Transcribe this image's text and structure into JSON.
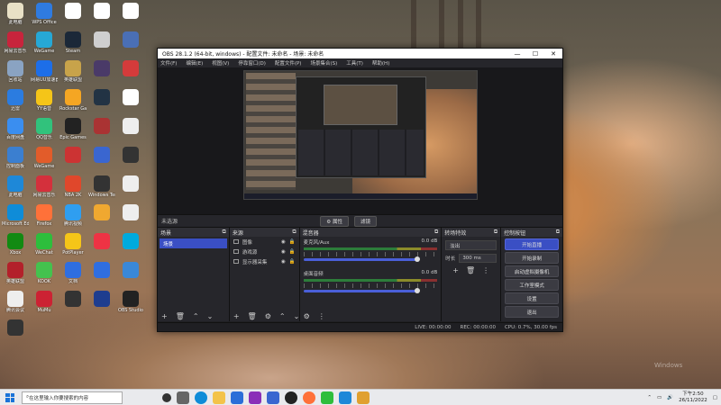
{
  "desktop": {
    "icons": [
      {
        "label": "此电脑",
        "color": "#e9e1c6"
      },
      {
        "label": "WPS Office",
        "color": "#2f7be0"
      },
      {
        "label": "",
        "color": "#ffffff"
      },
      {
        "label": "",
        "color": "#ffffff"
      },
      {
        "label": "",
        "color": "#ffffff"
      },
      {
        "label": "网易云音乐",
        "color": "#c8243c"
      },
      {
        "label": "WeGame",
        "color": "#26a8d6"
      },
      {
        "label": "Steam",
        "color": "#1b2838"
      },
      {
        "label": "",
        "color": "#cfcfcf"
      },
      {
        "label": "",
        "color": "#4a6fb5"
      },
      {
        "label": "回收站",
        "color": "#8aa3c2"
      },
      {
        "label": "网易UU加速器",
        "color": "#1d6ee8"
      },
      {
        "label": "英雄联盟",
        "color": "#c8a34a"
      },
      {
        "label": "",
        "color": "#4a3a68"
      },
      {
        "label": "",
        "color": "#d43b3b"
      },
      {
        "label": "迅雷",
        "color": "#2b7ce0"
      },
      {
        "label": "YY语音",
        "color": "#f5c518"
      },
      {
        "label": "Rockstar Games",
        "color": "#f5a623"
      },
      {
        "label": "",
        "color": "#234"
      },
      {
        "label": "",
        "color": "#fff"
      },
      {
        "label": "百度网盘",
        "color": "#3a8ef0"
      },
      {
        "label": "QQ音乐",
        "color": "#31c27c"
      },
      {
        "label": "Epic Games",
        "color": "#222"
      },
      {
        "label": "",
        "color": "#a33"
      },
      {
        "label": "",
        "color": "#eee"
      },
      {
        "label": "控制面板",
        "color": "#3b7fd0"
      },
      {
        "label": "WeGame",
        "color": "#e25c2a"
      },
      {
        "label": "",
        "color": "#cc3333"
      },
      {
        "label": "",
        "color": "#3a66d0"
      },
      {
        "label": "",
        "color": "#333"
      },
      {
        "label": "此电脑",
        "color": "#1e88d8"
      },
      {
        "label": "网易云音乐",
        "color": "#d4303c"
      },
      {
        "label": "NBA 2K",
        "color": "#e0472b"
      },
      {
        "label": "Windows Terminal",
        "color": "#333"
      },
      {
        "label": "",
        "color": "#eee"
      },
      {
        "label": "Microsoft Edge",
        "color": "#0f8cd8"
      },
      {
        "label": "Firefox",
        "color": "#ff7139"
      },
      {
        "label": "腾讯视频",
        "color": "#2f9ef0"
      },
      {
        "label": "",
        "color": "#f0a830"
      },
      {
        "label": "",
        "color": "#eee"
      },
      {
        "label": "Xbox",
        "color": "#128a12"
      },
      {
        "label": "WeChat",
        "color": "#2dbe3c"
      },
      {
        "label": "PotPlayer",
        "color": "#f5c518"
      },
      {
        "label": "",
        "color": "#e34"
      },
      {
        "label": "",
        "color": "#0ad"
      },
      {
        "label": "英雄联盟",
        "color": "#b3202a"
      },
      {
        "label": "KOOK",
        "color": "#44c24e"
      },
      {
        "label": "文档",
        "color": "#2f6ee0"
      },
      {
        "label": "",
        "color": "#2f6ee0"
      },
      {
        "label": "",
        "color": "#3a88d8"
      },
      {
        "label": "腾讯会议",
        "color": "#eee"
      },
      {
        "label": "MuMu",
        "color": "#cc2233"
      },
      {
        "label": "",
        "color": "#333"
      },
      {
        "label": "",
        "color": "#1e3d8f"
      },
      {
        "label": "OBS Studio",
        "color": "#222"
      },
      {
        "label": "",
        "color": "#333"
      }
    ],
    "watermark": "Windows"
  },
  "obs": {
    "title": "OBS 28.1.2 (64-bit, windows) - 配置文件: 未命名 - 场景: 未命名",
    "window_buttons": [
      "—",
      "☐",
      "✕"
    ],
    "menu": [
      "文件(F)",
      "编辑(E)",
      "视图(V)",
      "停靠窗口(D)",
      "配置文件(P)",
      "场景集合(S)",
      "工具(T)",
      "帮助(H)"
    ],
    "source_bar": {
      "name": "未选源",
      "properties": "属性",
      "filters": "滤镜"
    },
    "scenes": {
      "title": "场景",
      "items": [
        "场景"
      ]
    },
    "sources": {
      "title": "来源",
      "items": [
        "图像",
        "游戏源",
        "显示器采集"
      ]
    },
    "mixer": {
      "title": "混音器",
      "channels": [
        {
          "name": "麦克风/Aux",
          "db": "0.0 dB"
        },
        {
          "name": "桌面音频",
          "db": "0.0 dB"
        }
      ]
    },
    "transitions": {
      "title": "转场特效",
      "selected": "淡出",
      "duration_label": "时长",
      "duration": "300 ms"
    },
    "controls": {
      "title": "控制按钮",
      "buttons": [
        "开始直播",
        "开始录制",
        "启动虚拟摄像机",
        "工作室模式",
        "设置",
        "退出"
      ]
    },
    "status": {
      "live": "LIVE: 00:00:00",
      "rec": "REC: 00:00:00",
      "cpu": "CPU: 0.7%, 30.00 fps"
    }
  },
  "taskbar": {
    "search_placeholder": "在这里输入你要搜索的内容",
    "time": "下午2:50",
    "date": "26/11/2022"
  }
}
